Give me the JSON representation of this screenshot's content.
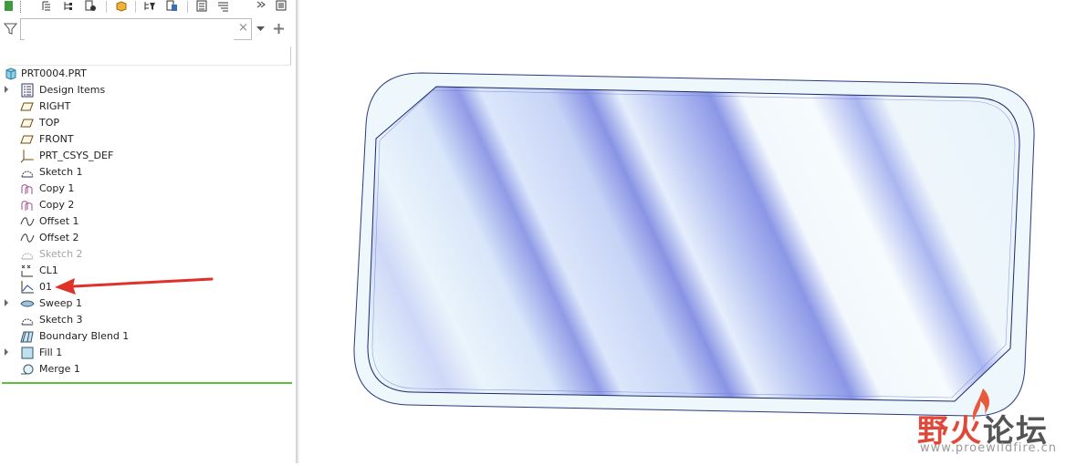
{
  "search": {
    "value": "",
    "placeholder": ""
  },
  "tree": {
    "root": {
      "label": "PRT0004.PRT",
      "icon": "part-icon"
    },
    "items": [
      {
        "label": "Design Items",
        "icon": "design-items-icon",
        "expandable": true
      },
      {
        "label": "RIGHT",
        "icon": "datum-plane-icon",
        "expandable": false
      },
      {
        "label": "TOP",
        "icon": "datum-plane-icon",
        "expandable": false
      },
      {
        "label": "FRONT",
        "icon": "datum-plane-icon",
        "expandable": false
      },
      {
        "label": "PRT_CSYS_DEF",
        "icon": "csys-icon",
        "expandable": false
      },
      {
        "label": "Sketch 1",
        "icon": "sketch-icon",
        "expandable": false
      },
      {
        "label": "Copy 1",
        "icon": "copy-icon",
        "expandable": false
      },
      {
        "label": "Copy 2",
        "icon": "copy-icon",
        "expandable": false
      },
      {
        "label": "Offset 1",
        "icon": "offset-icon",
        "expandable": false
      },
      {
        "label": "Offset 2",
        "icon": "offset-icon",
        "expandable": false
      },
      {
        "label": "Sketch 2",
        "icon": "sketch-icon",
        "expandable": false,
        "dimmed": true
      },
      {
        "label": "CL1",
        "icon": "curve-list-icon",
        "expandable": false
      },
      {
        "label": "01",
        "icon": "graph-icon",
        "expandable": false
      },
      {
        "label": "Sweep 1",
        "icon": "sweep-icon",
        "expandable": true
      },
      {
        "label": "Sketch 3",
        "icon": "sketch-icon",
        "expandable": false
      },
      {
        "label": "Boundary Blend 1",
        "icon": "boundary-blend-icon",
        "expandable": false
      },
      {
        "label": "Fill 1",
        "icon": "fill-icon",
        "expandable": true
      },
      {
        "label": "Merge 1",
        "icon": "merge-icon",
        "expandable": false
      }
    ]
  },
  "colors": {
    "accent_arrow": "#e0302a",
    "insert_line": "#5fbf3a",
    "surface_edge": "#1c2a6e",
    "surface_light": "#eef7fb",
    "surface_band": "#8f9bea"
  },
  "watermark": {
    "text_red": "野火",
    "text_dark": "论坛",
    "url": "www.proewildfire.cn"
  }
}
